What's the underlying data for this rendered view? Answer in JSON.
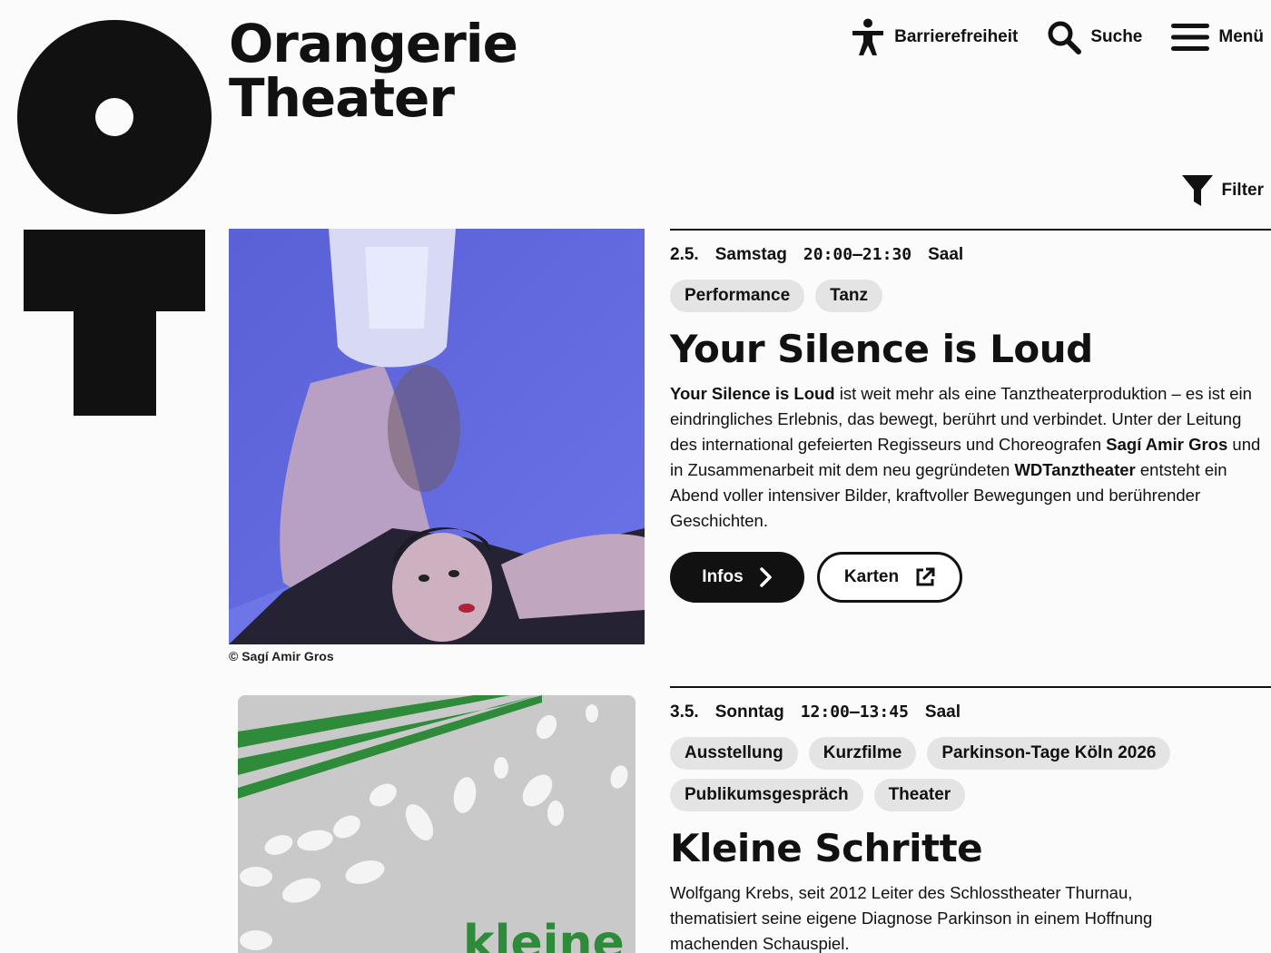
{
  "brand": {
    "line1": "Orangerie",
    "line2": "Theater"
  },
  "nav": {
    "accessibility": "Barrierefreiheit",
    "search": "Suche",
    "menu": "Menü"
  },
  "filter": {
    "label": "Filter"
  },
  "events": [
    {
      "date": "2.5.",
      "weekday": "Samstag",
      "time": "20:00–21:30",
      "venue": "Saal",
      "tags": [
        "Performance",
        "Tanz"
      ],
      "title": "Your Silence is Loud",
      "desc": {
        "b1": "Your Silence is Loud",
        "t1": " ist weit mehr als eine Tanztheaterproduktion – es ist ein eindringliches Erlebnis, das bewegt, berührt und verbindet. Unter der Leitung des international gefeierten Regisseurs und Choreografen ",
        "b2": "Sagí Amir Gros",
        "t2": " und in Zusammenarbeit mit dem neu gegründeten ",
        "b3": "WDTanztheater",
        "t3": " entsteht ein Abend voller intensiver Bilder, kraftvoller Bewegungen und berührender Geschichten."
      },
      "image_credit": "© Sagí Amir Gros",
      "buttons": {
        "info": "Infos",
        "tickets": "Karten"
      }
    },
    {
      "date": "3.5.",
      "weekday": "Sonntag",
      "time": "12:00–13:45",
      "venue": "Saal",
      "tags": [
        "Ausstellung",
        "Kurzfilme",
        "Parkinson-Tage Köln 2026",
        "Publikumsgespräch",
        "Theater"
      ],
      "title": "Kleine Schritte",
      "desc": "Wolfgang Krebs, seit 2012 Leiter des Schlosstheater Thurnau, thematisiert seine eigene Diagnose Parkinson in einem Hoffnung machenden Schauspiel.",
      "poster_text": "kleine"
    }
  ],
  "colors": {
    "poster_green": "#2e8b3a",
    "poster_bg": "#c9c9c9",
    "photo_blue": "#5b63d8"
  }
}
